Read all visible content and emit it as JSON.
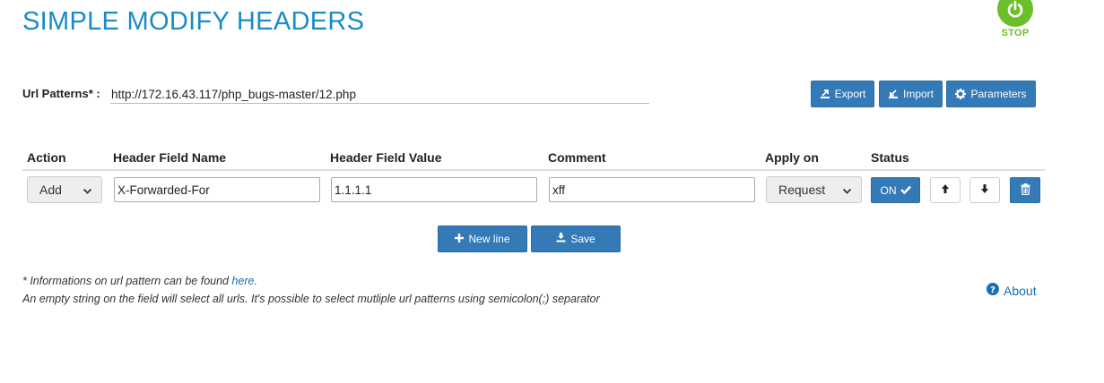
{
  "app": {
    "title": "SIMPLE MODIFY HEADERS",
    "stop_label": "STOP",
    "accent_color": "#1a8bc8",
    "stop_color": "#6cbf2a",
    "button_color": "#337ab7"
  },
  "url": {
    "label": "Url Patterns* :",
    "value": "http://172.16.43.117/php_bugs-master/12.php"
  },
  "toolbar": {
    "export_label": "Export",
    "import_label": "Import",
    "parameters_label": "Parameters"
  },
  "table": {
    "headers": {
      "action": "Action",
      "field_name": "Header Field Name",
      "field_value": "Header Field Value",
      "comment": "Comment",
      "apply_on": "Apply on",
      "status": "Status"
    },
    "rows": [
      {
        "action": "Add",
        "field_name": "X-Forwarded-For",
        "field_value": "1.1.1.1",
        "comment": "xff",
        "apply_on": "Request",
        "status": "ON"
      }
    ]
  },
  "actions": {
    "new_line_label": "New line",
    "save_label": "Save"
  },
  "notes": {
    "line1_prefix": "* Informations on url pattern can be found ",
    "line1_link": "here.",
    "line2": "An empty string on the field will select all urls. It's possible to select mutliple url patterns using semicolon(;) separator"
  },
  "about_label": "About",
  "icons": [
    "power-icon",
    "export-icon",
    "import-icon",
    "gear-icon",
    "chevron-down-icon",
    "check-icon",
    "arrow-up-icon",
    "arrow-down-icon",
    "trash-icon",
    "plus-icon",
    "download-icon",
    "question-circle-icon"
  ]
}
